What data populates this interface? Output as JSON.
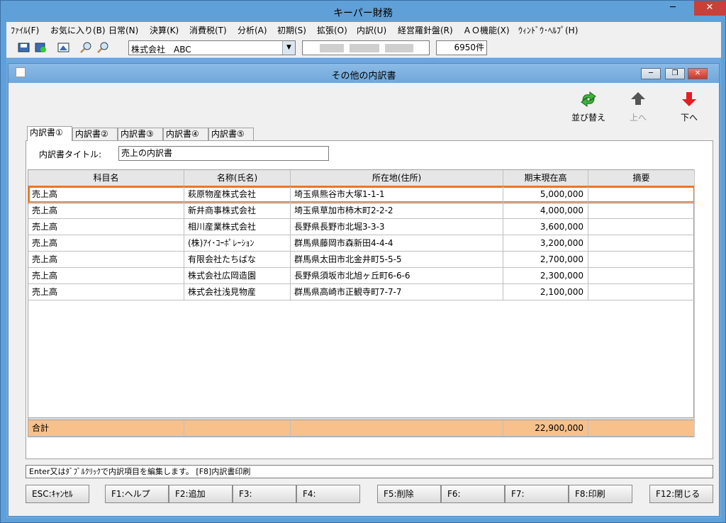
{
  "app": {
    "title": "キーパー財務"
  },
  "menu": [
    "ﾌｧｲﾙ(F)",
    "お気に入り(B)",
    "日常(N)",
    "決算(K)",
    "消費税(T)",
    "分析(A)",
    "初期(S)",
    "拡張(O)",
    "内訳(U)",
    "経営羅針盤(R)",
    "ＡＯ機能(X)",
    "ｳｨﾝﾄﾞｳ･ﾍﾙﾌﾟ(H)"
  ],
  "toolbar": {
    "company": "株式会社　ABC",
    "count": "6950件"
  },
  "window": {
    "title": "その他の内訳書"
  },
  "actions": {
    "sort": "並び替え",
    "up": "上へ",
    "down": "下へ"
  },
  "tabs": [
    "内訳書①",
    "内訳書②",
    "内訳書③",
    "内訳書④",
    "内訳書⑤"
  ],
  "form": {
    "title_label": "内訳書タイトル:",
    "title_value": "売上の内訳書"
  },
  "table": {
    "headers": [
      "科目名",
      "名称(氏名)",
      "所在地(住所)",
      "期末現在高",
      "摘要"
    ],
    "rows": [
      [
        "売上高",
        "萩原物産株式会社",
        "埼玉県熊谷市大塚1-1-1",
        "5,000,000",
        ""
      ],
      [
        "売上高",
        "新井商事株式会社",
        "埼玉県草加市柿木町2-2-2",
        "4,000,000",
        ""
      ],
      [
        "売上高",
        "相川産業株式会社",
        "長野県長野市北堀3-3-3",
        "3,600,000",
        ""
      ],
      [
        "売上高",
        "(株)ｱｲ･ｺｰﾎﾟﾚｰｼｮﾝ",
        "群馬県藤岡市森新田4-4-4",
        "3,200,000",
        ""
      ],
      [
        "売上高",
        "有限会社たちばな",
        "群馬県太田市北金井町5-5-5",
        "2,700,000",
        ""
      ],
      [
        "売上高",
        "株式会社広岡造園",
        "長野県須坂市北旭ヶ丘町6-6-6",
        "2,300,000",
        ""
      ],
      [
        "売上高",
        "株式会社浅見物産",
        "群馬県高崎市正観寺町7-7-7",
        "2,100,000",
        ""
      ]
    ],
    "total": {
      "label": "合計",
      "amount": "22,900,000"
    }
  },
  "status": "Enter又はﾀﾞﾌﾞﾙｸﾘｯｸで内訳項目を編集します。 [F8]内訳書印刷",
  "fkeys": [
    "ESC:ｷｬﾝｾﾙ",
    "F1:ヘルプ",
    "F2:追加",
    "F3:",
    "F4:",
    "F5:削除",
    "F6:",
    "F7:",
    "F8:印刷",
    "F12:閉じる"
  ],
  "colors": {
    "selection": "#e8762a",
    "total_row": "#f8c08a",
    "title_bar": "#5fa0d8"
  }
}
